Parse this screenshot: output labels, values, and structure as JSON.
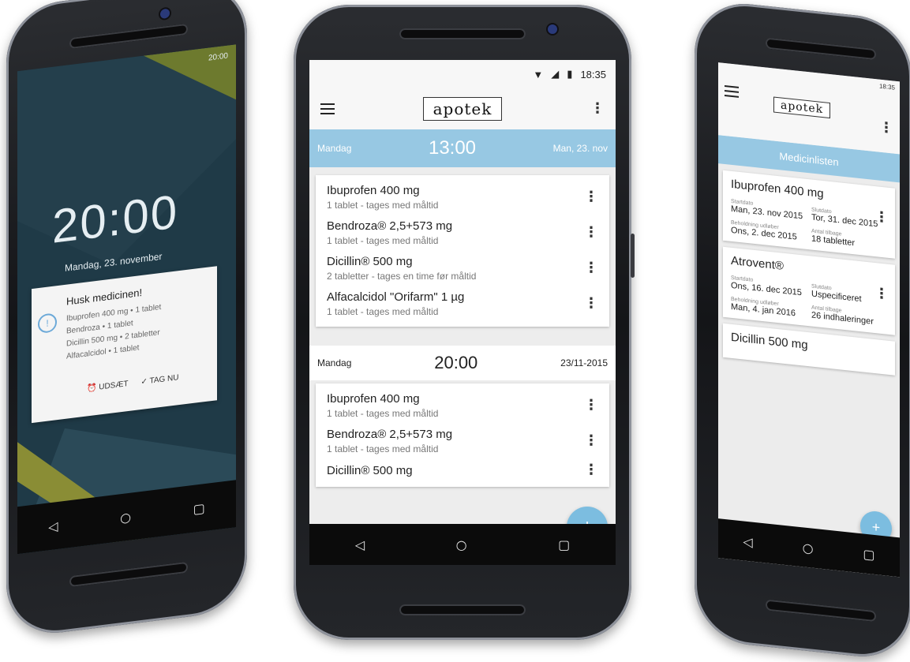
{
  "left_phone": {
    "lock_time": "20:00",
    "lock_date": "Mandag, 23. november",
    "status_time": "20:00",
    "notification": {
      "title": "Husk medicinen!",
      "lines": [
        "Ibuprofen 400 mg • 1 tablet",
        "Bendroza • 1 tablet",
        "Dicillin 500 mg • 2 tabletter",
        "Alfacalcidol • 1 tablet"
      ],
      "snooze_label": "UDSÆT",
      "take_label": "TAG NU"
    }
  },
  "center_phone": {
    "status_time": "18:35",
    "logo": "apotek",
    "section1": {
      "day": "Mandag",
      "time": "13:00",
      "date": "Man, 23. nov"
    },
    "section1_meds": [
      {
        "name": "Ibuprofen 400 mg",
        "dose": "1 tablet - tages med måltid"
      },
      {
        "name": "Bendroza® 2,5+573 mg",
        "dose": "1 tablet - tages med måltid"
      },
      {
        "name": "Dicillin® 500 mg",
        "dose": "2 tabletter - tages en time før måltid"
      },
      {
        "name": "Alfacalcidol \"Orifarm\" 1 µg",
        "dose": "1 tablet - tages med måltid"
      }
    ],
    "section2": {
      "day": "Mandag",
      "time": "20:00",
      "date": "23/11-2015"
    },
    "section2_meds": [
      {
        "name": "Ibuprofen 400 mg",
        "dose": "1 tablet - tages med måltid"
      },
      {
        "name": "Bendroza® 2,5+573 mg",
        "dose": "1 tablet - tages med måltid"
      },
      {
        "name": "Dicillin® 500 mg",
        "dose": ""
      }
    ],
    "fab_label": "+"
  },
  "right_phone": {
    "status_time": "18:35",
    "logo": "apotek",
    "band_title": "Medicinlisten",
    "cards": [
      {
        "title": "Ibuprofen 400 mg",
        "fields": [
          {
            "label": "Startdato",
            "value": "Man, 23. nov 2015"
          },
          {
            "label": "Slutdato",
            "value": "Tor, 31. dec 2015"
          },
          {
            "label": "Beholdning udløber",
            "value": "Ons, 2. dec 2015"
          },
          {
            "label": "Antal tilbage",
            "value": "18 tabletter"
          }
        ]
      },
      {
        "title": "Atrovent®",
        "fields": [
          {
            "label": "Startdato",
            "value": "Ons, 16. dec 2015"
          },
          {
            "label": "Slutdato",
            "value": "Uspecificeret"
          },
          {
            "label": "Beholdning udløber",
            "value": "Man, 4. jan 2016"
          },
          {
            "label": "Antal tilbage",
            "value": "26 indhaleringer"
          }
        ]
      },
      {
        "title": "Dicillin 500 mg",
        "fields": []
      }
    ],
    "fab_label": "+"
  },
  "nav_icons": [
    "back-icon",
    "home-icon",
    "recents-icon"
  ],
  "colors": {
    "accent": "#97c8e3",
    "fab": "#7cbde0",
    "lockscreen": "#1f3a47"
  }
}
